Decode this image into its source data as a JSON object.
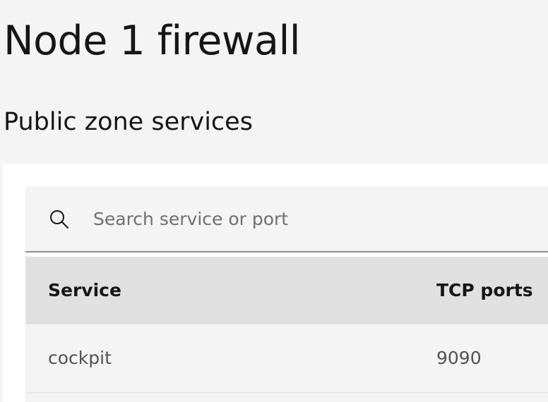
{
  "page": {
    "title": "Node 1 firewall"
  },
  "zone": {
    "title": "Public zone services"
  },
  "search": {
    "icon": "search-icon",
    "placeholder": "Search service or port",
    "value": ""
  },
  "table": {
    "columns": [
      "Service",
      "TCP ports"
    ],
    "rows": [
      {
        "service": "cockpit",
        "tcp_ports": "9090"
      }
    ]
  }
}
